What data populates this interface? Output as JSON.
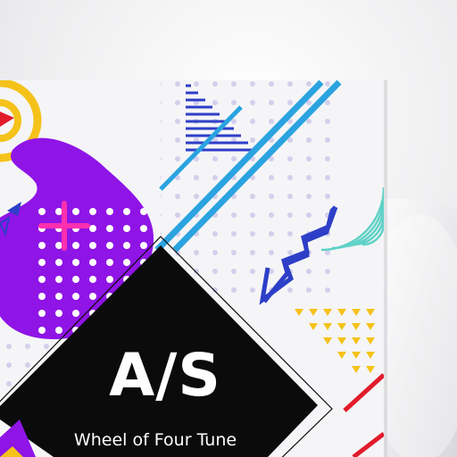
{
  "cover": {
    "title": "A/S",
    "subtitle": "Wheel of Four Tune"
  },
  "colors": {
    "background": "#ececee",
    "card": "#f5f5f7",
    "purple": "#8f14e6",
    "blue": "#2aa3e0",
    "navy": "#2d3fc7",
    "yellow": "#f5c21a",
    "red": "#e21b2b",
    "teal": "#5fd1c6",
    "magenta": "#ff2fb0",
    "dot": "#cfcbea",
    "diamond": "#0b0b0b"
  }
}
